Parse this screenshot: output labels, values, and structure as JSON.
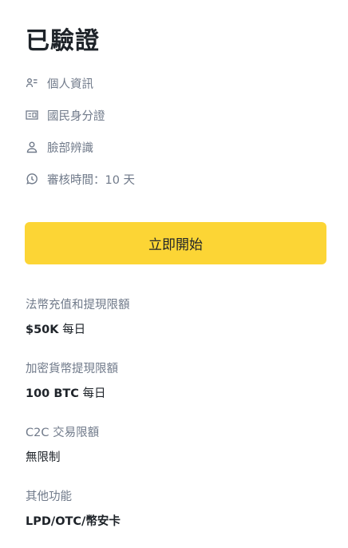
{
  "header": {
    "title": "已驗證"
  },
  "requirements": [
    {
      "icon": "personal-info-icon",
      "label": "個人資訊"
    },
    {
      "icon": "id-card-icon",
      "label": "國民身分證"
    },
    {
      "icon": "face-verification-icon",
      "label": "臉部辨識"
    },
    {
      "icon": "review-time-icon",
      "label": "審核時間：10 天"
    }
  ],
  "action": {
    "start_label": "立即開始"
  },
  "limits": [
    {
      "label": "法幣充值和提現限額",
      "amount": "$50K",
      "suffix": " 每日"
    },
    {
      "label": "加密貨幣提現限額",
      "amount": "100 BTC",
      "suffix": " 每日"
    },
    {
      "label": "C2C 交易限額",
      "amount": "",
      "suffix": "無限制"
    },
    {
      "label": "其他功能",
      "amount": "LPD/OTC/幣安卡",
      "suffix": ""
    }
  ],
  "colors": {
    "accent": "#fcd535",
    "text_primary": "#1e2329",
    "text_secondary": "#707a8a"
  }
}
